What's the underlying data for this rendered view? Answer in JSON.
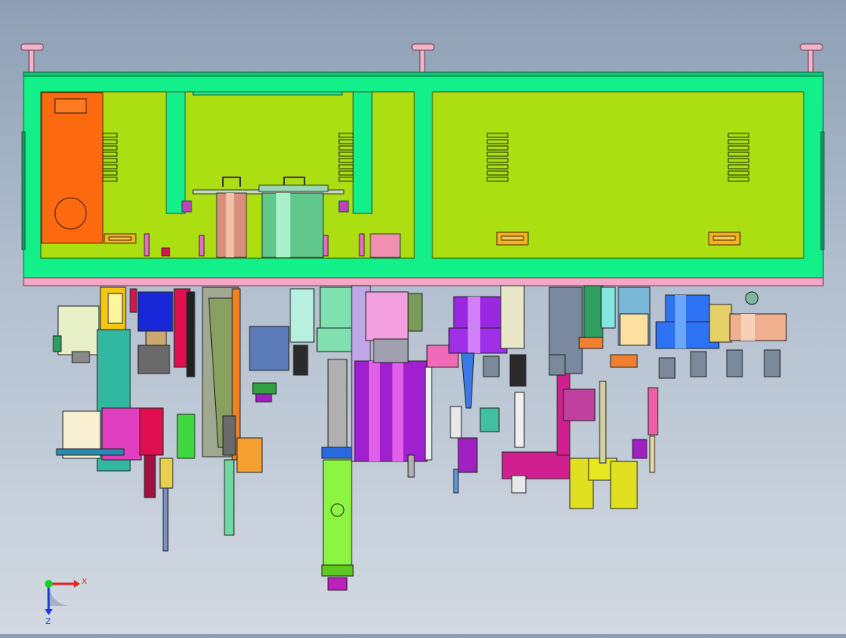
{
  "viewport": {
    "background_top": "#8e9fb4",
    "background_bottom": "#d2d9e2",
    "model_colors": {
      "frame": "#13f08a",
      "panel": "#acdf12",
      "enclosure": "#ff6a10",
      "rail": "#f4a7c7",
      "cylinder_blue": "#2e72f5",
      "cylinder_purple": "#8a2fd6",
      "vertical_green": "#8cf540"
    }
  },
  "triad": {
    "x_label": "X",
    "z_label": "Z",
    "x_color": "#e62020",
    "z_color": "#2236e0",
    "y_color": "#14d220"
  }
}
